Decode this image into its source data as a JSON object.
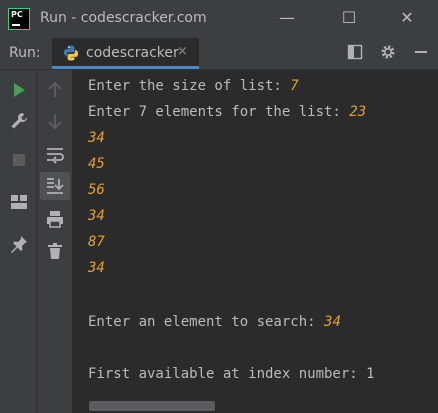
{
  "window": {
    "title": "Run - codescracker.com",
    "logo_text": "PC",
    "minimize_glyph": "—",
    "maximize_glyph": "☐",
    "close_glyph": "✕"
  },
  "run_panel": {
    "label": "Run:",
    "tab_label": "codescracker",
    "tab_close_glyph": "×"
  },
  "console": {
    "lines": [
      {
        "prompt": "Enter the size of list: ",
        "input": "7"
      },
      {
        "prompt": "Enter 7 elements for the list: ",
        "input": "23"
      },
      {
        "prompt": "",
        "input": "34"
      },
      {
        "prompt": "",
        "input": "45"
      },
      {
        "prompt": "",
        "input": "56"
      },
      {
        "prompt": "",
        "input": "34"
      },
      {
        "prompt": "",
        "input": "87"
      },
      {
        "prompt": "",
        "input": "34"
      },
      {
        "prompt": "",
        "input": ""
      },
      {
        "prompt": "Enter an element to search: ",
        "input": "34"
      },
      {
        "prompt": "",
        "input": ""
      },
      {
        "prompt": "First available at index number: 1",
        "input": ""
      }
    ]
  },
  "colors": {
    "input_text": "#e7a02f",
    "output_text": "#bbbbbb",
    "run_green": "#499c54",
    "background": "#2b2b2b",
    "panel": "#3c3f41"
  }
}
